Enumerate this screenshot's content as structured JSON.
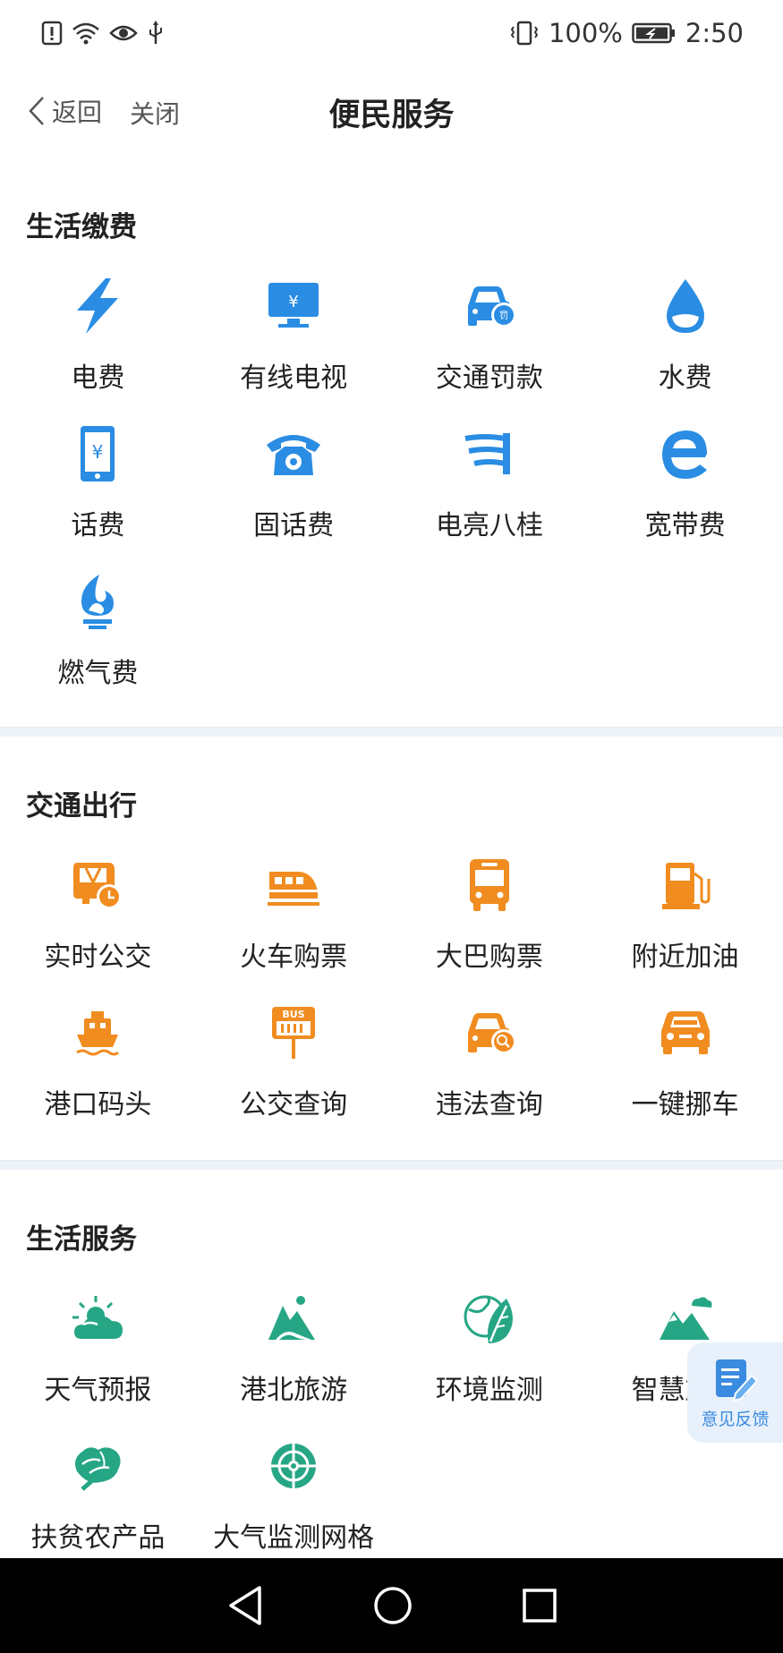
{
  "status": {
    "battery": "100%",
    "time": "2:50"
  },
  "nav": {
    "back_label": "返回",
    "close_label": "关闭",
    "title": "便民服务"
  },
  "colors": {
    "blue": "#2a8de3",
    "orange": "#f08c20",
    "green": "#26a685"
  },
  "sections": [
    {
      "title": "生活缴费",
      "items": [
        {
          "label": "电费",
          "icon": "lightning-icon"
        },
        {
          "label": "有线电视",
          "icon": "tv-icon"
        },
        {
          "label": "交通罚款",
          "icon": "car-fine-icon"
        },
        {
          "label": "水费",
          "icon": "water-drop-icon"
        },
        {
          "label": "话费",
          "icon": "phone-yuan-icon"
        },
        {
          "label": "固话费",
          "icon": "telephone-icon"
        },
        {
          "label": "电亮八桂",
          "icon": "power-lines-icon"
        },
        {
          "label": "宽带费",
          "icon": "browser-e-icon"
        },
        {
          "label": "燃气费",
          "icon": "gas-flame-icon"
        }
      ]
    },
    {
      "title": "交通出行",
      "items": [
        {
          "label": "实时公交",
          "icon": "bus-clock-icon"
        },
        {
          "label": "火车购票",
          "icon": "train-icon"
        },
        {
          "label": "大巴购票",
          "icon": "coach-bus-icon"
        },
        {
          "label": "附近加油",
          "icon": "fuel-pump-icon"
        },
        {
          "label": "港口码头",
          "icon": "ship-icon"
        },
        {
          "label": "公交查询",
          "icon": "bus-stop-sign-icon"
        },
        {
          "label": "违法查询",
          "icon": "car-search-icon"
        },
        {
          "label": "一键挪车",
          "icon": "car-move-icon"
        }
      ]
    },
    {
      "title": "生活服务",
      "items": [
        {
          "label": "天气预报",
          "icon": "sun-cloud-icon"
        },
        {
          "label": "港北旅游",
          "icon": "mountain-icon"
        },
        {
          "label": "环境监测",
          "icon": "leaf-globe-icon"
        },
        {
          "label": "智慧旅游",
          "icon": "mountains-cloud-icon"
        },
        {
          "label": "扶贫农产品",
          "icon": "vegetable-icon"
        },
        {
          "label": "大气监测网格",
          "icon": "target-grid-icon"
        }
      ]
    }
  ],
  "feedback": {
    "label": "意见反馈"
  }
}
